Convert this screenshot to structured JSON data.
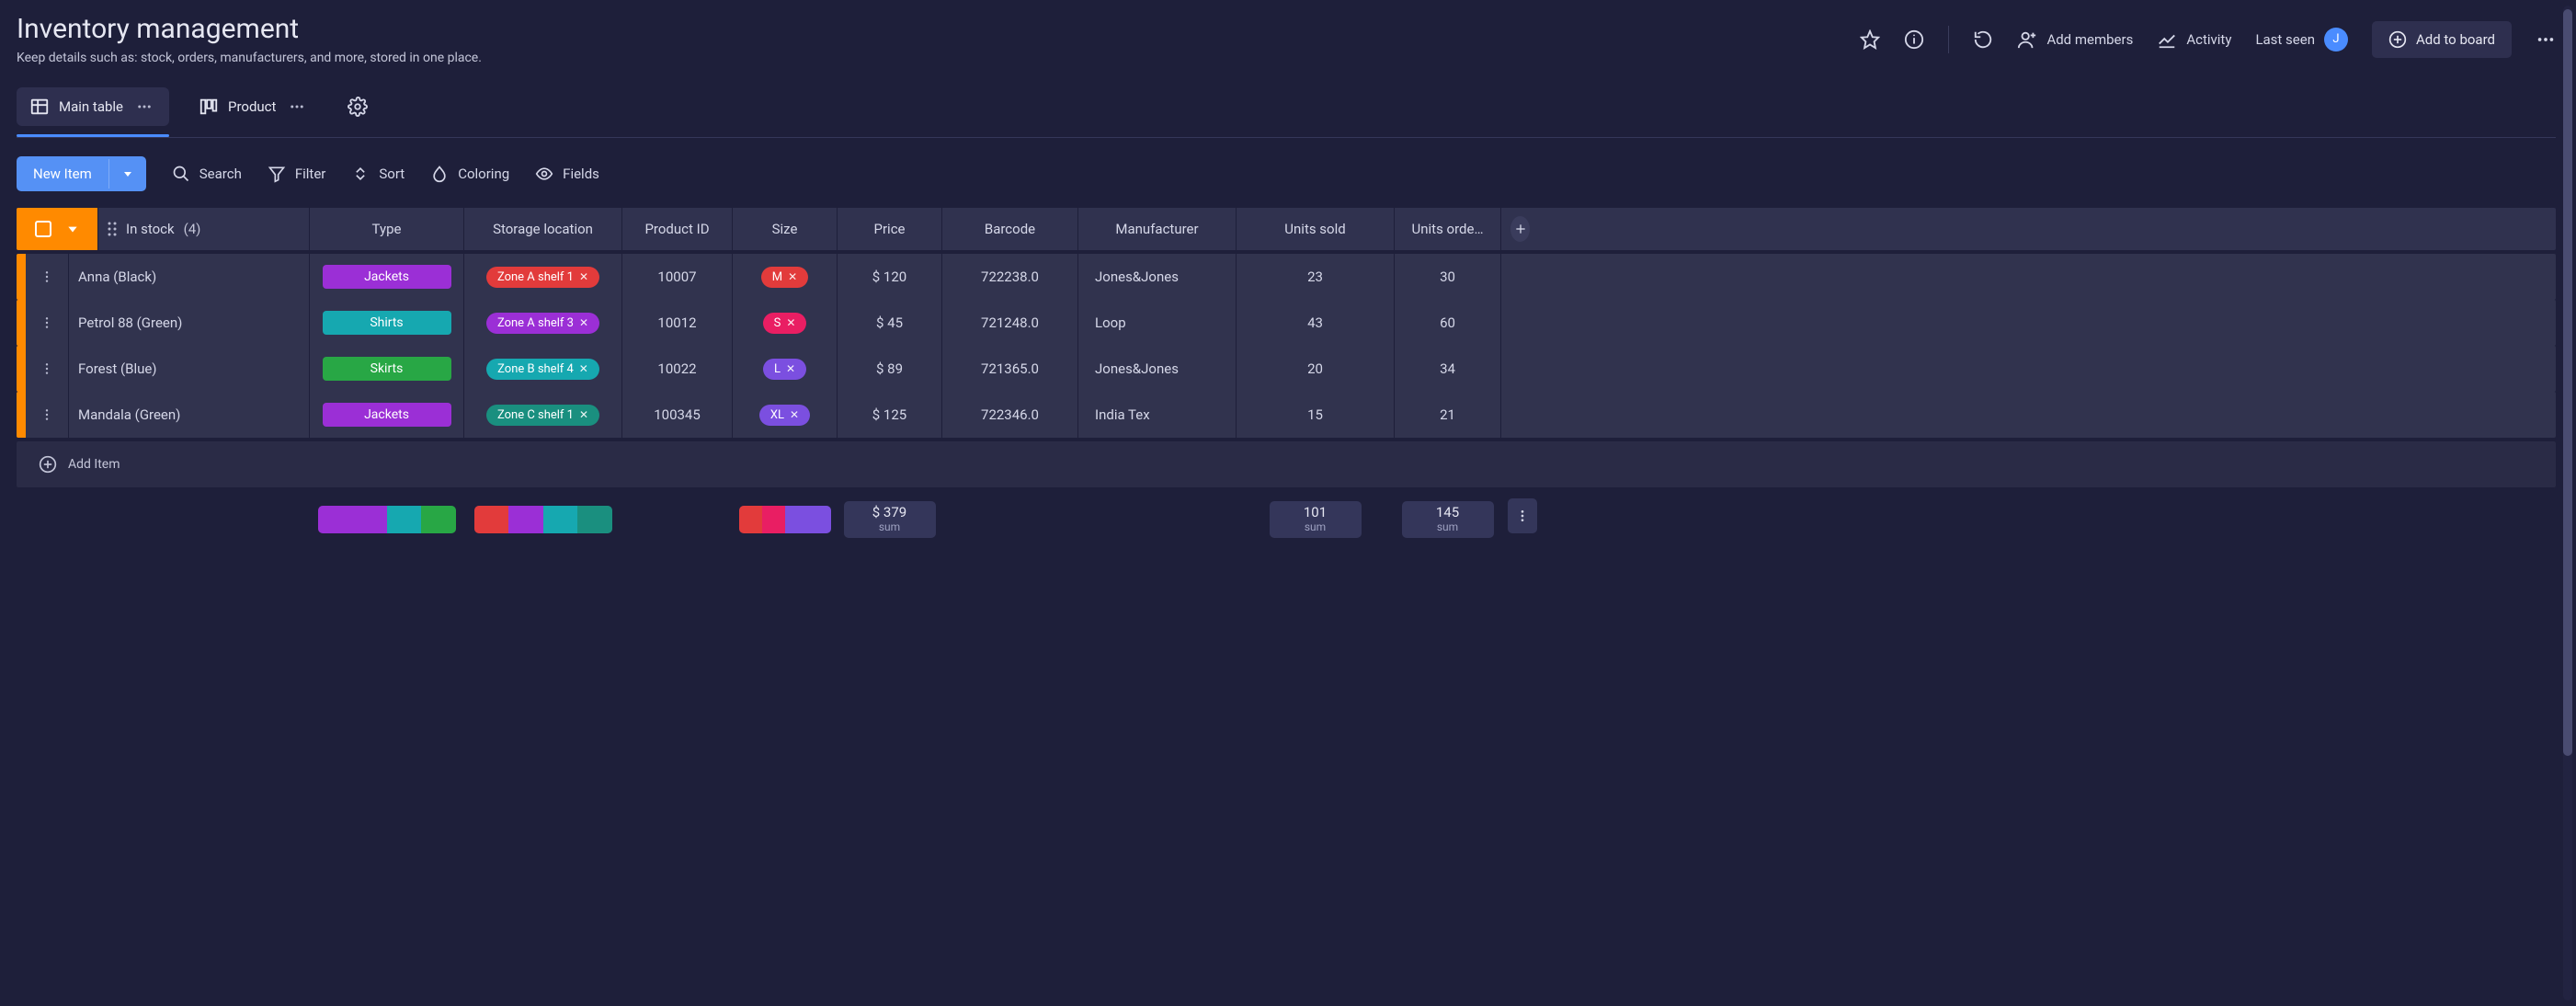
{
  "header": {
    "title": "Inventory management",
    "subtitle": "Keep details such as: stock, orders, manufacturers, and more, stored in one place.",
    "add_members": "Add members",
    "activity": "Activity",
    "last_seen": "Last seen",
    "last_seen_avatar": "J",
    "add_to_board": "Add to board"
  },
  "views": {
    "main_table": "Main table",
    "product": "Product"
  },
  "toolbar": {
    "new_item": "New Item",
    "search": "Search",
    "filter": "Filter",
    "sort": "Sort",
    "coloring": "Coloring",
    "fields": "Fields"
  },
  "group": {
    "name": "In stock",
    "count": "(4)"
  },
  "columns": {
    "type": "Type",
    "storage": "Storage location",
    "product_id": "Product ID",
    "size": "Size",
    "price": "Price",
    "barcode": "Barcode",
    "manufacturer": "Manufacturer",
    "units_sold": "Units sold",
    "units_ordered": "Units orde…"
  },
  "rows": [
    {
      "name": "Anna (Black)",
      "type": "Jackets",
      "type_color": "pill-purple",
      "storage": "Zone A shelf 1",
      "storage_color": "tag-red",
      "product_id": "10007",
      "size": "M",
      "size_color": "tag-red",
      "price": "$ 120",
      "barcode": "722238.0",
      "manufacturer": "Jones&Jones",
      "units_sold": "23",
      "units_ordered": "30"
    },
    {
      "name": "Petrol 88 (Green)",
      "type": "Shirts",
      "type_color": "pill-teal",
      "storage": "Zone A shelf 3",
      "storage_color": "tag-purple",
      "product_id": "10012",
      "size": "S",
      "size_color": "tag-pink",
      "price": "$ 45",
      "barcode": "721248.0",
      "manufacturer": "Loop",
      "units_sold": "43",
      "units_ordered": "60"
    },
    {
      "name": "Forest (Blue)",
      "type": "Skirts",
      "type_color": "pill-green",
      "storage": "Zone B shelf 4",
      "storage_color": "tag-tealB",
      "product_id": "10022",
      "size": "L",
      "size_color": "tag-violet",
      "price": "$ 89",
      "barcode": "721365.0",
      "manufacturer": "Jones&Jones",
      "units_sold": "20",
      "units_ordered": "34"
    },
    {
      "name": "Mandala (Green)",
      "type": "Jackets",
      "type_color": "pill-purple",
      "storage": "Zone C shelf 1",
      "storage_color": "tag-teal",
      "product_id": "100345",
      "size": "XL",
      "size_color": "tag-violet",
      "price": "$ 125",
      "barcode": "722346.0",
      "manufacturer": "India Tex",
      "units_sold": "15",
      "units_ordered": "21"
    }
  ],
  "add_item": "Add Item",
  "footer": {
    "price_sum": "$ 379",
    "price_label": "sum",
    "sold_sum": "101",
    "sold_label": "sum",
    "ord_sum": "145",
    "ord_label": "sum",
    "type_segments": [
      {
        "color": "#9b2fd6",
        "w": 50
      },
      {
        "color": "#16a8b0",
        "w": 25
      },
      {
        "color": "#28a745",
        "w": 25
      }
    ],
    "storage_segments": [
      {
        "color": "#e23b3b",
        "w": 25
      },
      {
        "color": "#9b2fd6",
        "w": 25
      },
      {
        "color": "#16a8b0",
        "w": 25
      },
      {
        "color": "#1a8f7f",
        "w": 25
      }
    ],
    "size_segments": [
      {
        "color": "#e23b3b",
        "w": 25
      },
      {
        "color": "#e91e63",
        "w": 25
      },
      {
        "color": "#7b4fe0",
        "w": 50
      }
    ]
  }
}
